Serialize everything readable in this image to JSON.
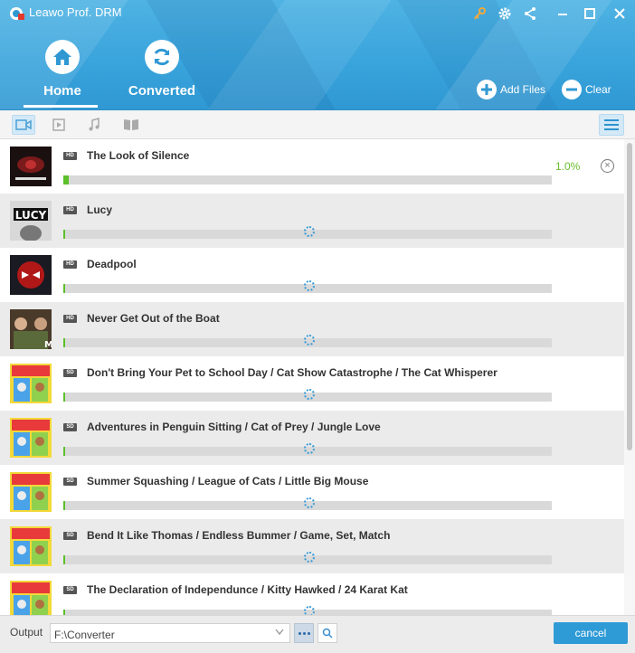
{
  "app": {
    "title": "Leawo Prof. DRM"
  },
  "nav": {
    "home_label": "Home",
    "converted_label": "Converted"
  },
  "actions": {
    "add_files_label": "Add Files",
    "clear_label": "Clear"
  },
  "filters": [
    "video-icon",
    "movie-icon",
    "music-icon",
    "book-icon"
  ],
  "items": [
    {
      "title": "The Look of Silence",
      "quality": "HD",
      "progress": 1.0,
      "percent_label": "1.0%",
      "active": true
    },
    {
      "title": "Lucy",
      "quality": "HD",
      "progress": 0,
      "percent_label": "",
      "active": false
    },
    {
      "title": "Deadpool",
      "quality": "HD",
      "progress": 0,
      "percent_label": "",
      "active": false
    },
    {
      "title": "Never Get Out of the Boat",
      "quality": "HD",
      "progress": 0,
      "percent_label": "",
      "active": false
    },
    {
      "title": "Don't Bring Your Pet to School Day / Cat Show Catastrophe / The Cat Whisperer",
      "quality": "SD",
      "progress": 0,
      "percent_label": "",
      "active": false
    },
    {
      "title": "Adventures in Penguin Sitting / Cat of Prey / Jungle Love",
      "quality": "SD",
      "progress": 0,
      "percent_label": "",
      "active": false
    },
    {
      "title": "Summer Squashing / League of Cats / Little Big Mouse",
      "quality": "SD",
      "progress": 0,
      "percent_label": "",
      "active": false
    },
    {
      "title": "Bend It Like Thomas / Endless Bummer / Game, Set, Match",
      "quality": "SD",
      "progress": 0,
      "percent_label": "",
      "active": false
    },
    {
      "title": "The Declaration of Independunce / Kitty Hawked / 24 Karat Kat",
      "quality": "SD",
      "progress": 0,
      "percent_label": "",
      "active": false
    }
  ],
  "footer": {
    "output_label": "Output",
    "output_path": "F:\\Converter",
    "cancel_label": "cancel"
  },
  "colors": {
    "accent": "#2e9ad6",
    "progress": "#5cc02a",
    "header": "#3aa4dc"
  }
}
